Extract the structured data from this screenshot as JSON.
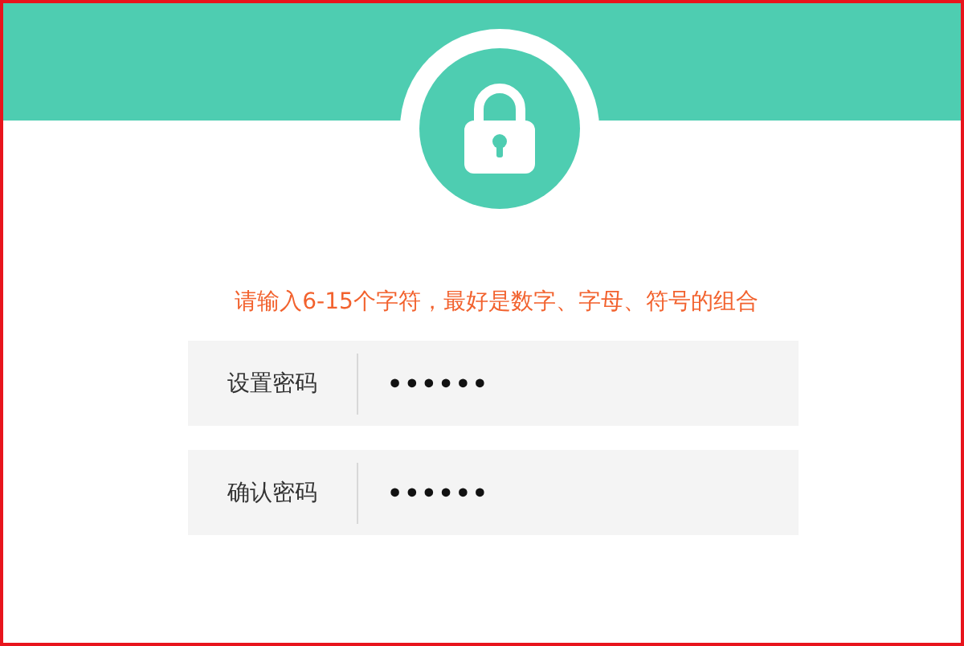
{
  "hint": "请输入6-15个字符，最好是数字、字母、符号的组合",
  "fields": [
    {
      "label": "设置密码",
      "value": "••••••"
    },
    {
      "label": "确认密码",
      "value": "••••••"
    }
  ]
}
